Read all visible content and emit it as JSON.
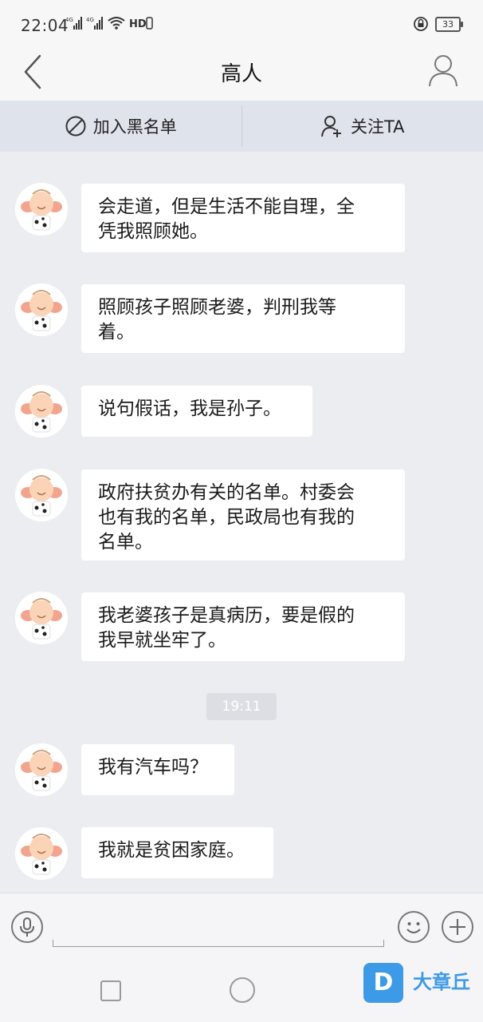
{
  "status_bar": {
    "time": "22:04",
    "network_1": "4G",
    "network_2": "4G",
    "hd_label": "HD",
    "battery": "33"
  },
  "nav": {
    "title": "高人",
    "back_icon": "chevron-left-icon",
    "profile_icon": "person-icon"
  },
  "actions": {
    "blacklist_label": "加入黑名单",
    "follow_label": "关注TA"
  },
  "messages": [
    {
      "text_line1": "会走道，但是生活不能自理，全",
      "text_line2": "凭我照顾她。"
    },
    {
      "text_line1": "照顾孩子照顾老婆，判刑我等",
      "text_line2": "着。"
    },
    {
      "text_line1": "说句假话，我是孙子。"
    },
    {
      "text_line1": "政府扶贫办有关的名单。村委会",
      "text_line2": "也有我的名单，民政局也有我的",
      "text_line3": "名单。"
    },
    {
      "text_line1": "我老婆孩子是真病历，要是假的",
      "text_line2": "我早就坐牢了。"
    },
    {
      "text_line1": "我有汽车吗？"
    },
    {
      "text_line1": "我就是贫困家庭。"
    }
  ],
  "time_separator": "19:11",
  "watermark": {
    "logo_letter": "D",
    "text": "大章丘"
  },
  "colors": {
    "background": "#ecedf1",
    "bubble": "#ffffff",
    "action_bar": "#dfe3ec",
    "watermark": "#3d9ae6"
  }
}
